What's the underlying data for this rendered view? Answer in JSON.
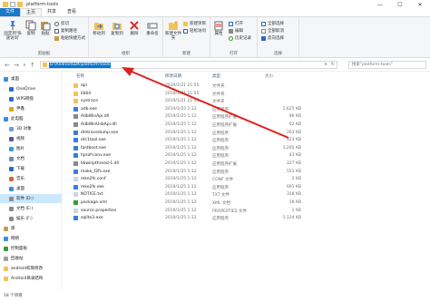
{
  "title": "platform-tools",
  "tabs": [
    "文件",
    "主页",
    "共享",
    "查看"
  ],
  "ribbon": {
    "clipboard": {
      "pin": "固定到'快速访问'",
      "copy": "复制",
      "paste": "粘贴",
      "cut": "剪切",
      "copypath": "复制路径",
      "pasteshortcut": "粘贴快捷方式",
      "label": "剪贴板"
    },
    "organize": {
      "moveto": "移动到",
      "copyto": "复制到",
      "delete": "删除",
      "rename": "重命名",
      "label": "组织"
    },
    "new": {
      "newfolder": "新建文件夹",
      "newitem": "新建项目",
      "easyaccess": "轻松访问",
      "label": "新建"
    },
    "open": {
      "properties": "属性",
      "open": "打开",
      "edit": "编辑",
      "history": "历史记录",
      "label": "打开"
    },
    "select": {
      "selectall": "全部选择",
      "selectnone": "全部取消",
      "invert": "反向选择",
      "label": "选择"
    }
  },
  "address": {
    "path": "D:\\AndroidSDK\\platform-tools",
    "search_placeholder": "搜索\"platform-tools\""
  },
  "sidebar": [
    {
      "label": "桌面",
      "icon": "desktop-icon",
      "sel": false
    },
    {
      "label": "OneDrive",
      "icon": "cloud-icon",
      "sel": false
    },
    {
      "label": "WPS网盘",
      "icon": "cloud-icon",
      "sel": false
    },
    {
      "label": "尹鑫",
      "icon": "user-icon",
      "sel": false
    },
    {
      "label": "此电脑",
      "icon": "computer-icon",
      "sel": false
    },
    {
      "label": "3D 对象",
      "icon": "cube-icon",
      "sel": false
    },
    {
      "label": "视频",
      "icon": "video-icon",
      "sel": false
    },
    {
      "label": "图片",
      "icon": "picture-icon",
      "sel": false
    },
    {
      "label": "文档",
      "icon": "document-icon",
      "sel": false
    },
    {
      "label": "下载",
      "icon": "download-icon",
      "sel": false
    },
    {
      "label": "音乐",
      "icon": "music-icon",
      "sel": false
    },
    {
      "label": "桌面",
      "icon": "desktop-icon",
      "sel": false
    },
    {
      "label": "软件 (D:)",
      "icon": "drive-icon",
      "sel": true
    },
    {
      "label": "文档 (E:)",
      "icon": "drive-icon",
      "sel": false
    },
    {
      "label": "娱乐 (F:)",
      "icon": "drive-icon",
      "sel": false
    },
    {
      "label": "库",
      "icon": "library-icon",
      "sel": false
    },
    {
      "label": "网络",
      "icon": "network-icon",
      "sel": false
    },
    {
      "label": "控制面板",
      "icon": "control-panel-icon",
      "sel": false
    },
    {
      "label": "回收站",
      "icon": "recycle-bin-icon",
      "sel": false
    },
    {
      "label": "android权限修改",
      "icon": "folder-icon",
      "sel": false
    },
    {
      "label": "Android目录结构",
      "icon": "folder-icon",
      "sel": false
    }
  ],
  "columns": [
    "名称",
    "修改日期",
    "类型",
    "大小"
  ],
  "files": [
    {
      "name": "api",
      "date": "2019/1/21 21:55",
      "type": "文件夹",
      "size": "",
      "kind": "folder"
    },
    {
      "name": "lib64",
      "date": "2019/1/21 21:55",
      "type": "文件夹",
      "size": "",
      "kind": "folder"
    },
    {
      "name": "systrace",
      "date": "2019/1/21 21:55",
      "type": "文件夹",
      "size": "",
      "kind": "folder"
    },
    {
      "name": "adb.exe",
      "date": "2019/1/25 1:12",
      "type": "应用程序",
      "size": "1,625 KB",
      "kind": "exe"
    },
    {
      "name": "AdbWinApi.dll",
      "date": "2019/1/25 1:12",
      "type": "应用程序扩展",
      "size": "96 KB",
      "kind": "dll"
    },
    {
      "name": "AdbWinUsbApi.dll",
      "date": "2019/1/25 1:12",
      "type": "应用程序扩展",
      "size": "62 KB",
      "kind": "dll"
    },
    {
      "name": "dmtracedump.exe",
      "date": "2019/1/25 1:12",
      "type": "应用程序",
      "size": "263 KB",
      "kind": "exe"
    },
    {
      "name": "etc1tool.exe",
      "date": "2019/1/25 1:12",
      "type": "应用程序",
      "size": "423 KB",
      "kind": "exe"
    },
    {
      "name": "fastboot.exe",
      "date": "2019/1/25 1:12",
      "type": "应用程序",
      "size": "1,205 KB",
      "kind": "exe"
    },
    {
      "name": "hprof-conv.exe",
      "date": "2019/1/25 1:12",
      "type": "应用程序",
      "size": "43 KB",
      "kind": "exe"
    },
    {
      "name": "libwinpthread-1.dll",
      "date": "2019/1/25 1:12",
      "type": "应用程序扩展",
      "size": "227 KB",
      "kind": "dll"
    },
    {
      "name": "make_f2fs.exe",
      "date": "2019/1/25 1:12",
      "type": "应用程序",
      "size": "551 KB",
      "kind": "exe"
    },
    {
      "name": "mke2fs.conf",
      "date": "2019/1/25 1:12",
      "type": "CONF 文件",
      "size": "2 KB",
      "kind": "file"
    },
    {
      "name": "mke2fs.exe",
      "date": "2019/1/25 1:12",
      "type": "应用程序",
      "size": "691 KB",
      "kind": "exe"
    },
    {
      "name": "NOTICE.txt",
      "date": "2019/1/25 1:12",
      "type": "TXT 文件",
      "size": "318 KB",
      "kind": "file"
    },
    {
      "name": "package.xml",
      "date": "2019/1/25 1:12",
      "type": "XML 文档",
      "size": "18 KB",
      "kind": "xml"
    },
    {
      "name": "source.properties",
      "date": "2019/1/25 1:12",
      "type": "PROPERTIES 文件",
      "size": "1 KB",
      "kind": "file"
    },
    {
      "name": "sqlite3.exe",
      "date": "2019/1/25 1:12",
      "type": "应用程序",
      "size": "1,124 KB",
      "kind": "exe"
    }
  ],
  "status": "18 个项目",
  "colors": {
    "accent": "#0078d7",
    "selection": "#cce8ff",
    "arrow": "#e02020",
    "folder": "#f0c35a"
  }
}
